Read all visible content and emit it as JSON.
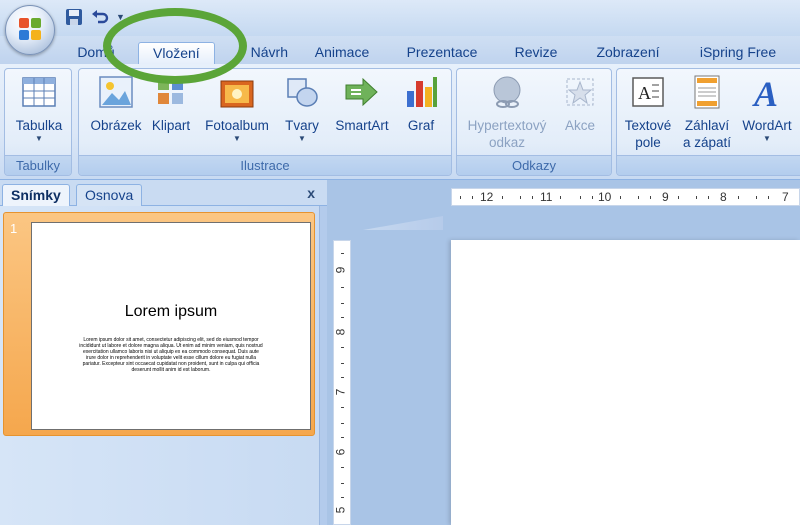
{
  "quick_access": {
    "icons": [
      "office-logo",
      "save-icon",
      "undo-icon",
      "qat-dropdown-icon"
    ]
  },
  "tabs": [
    {
      "label": "Domů"
    },
    {
      "label": "Vložení"
    },
    {
      "label": "Návrh"
    },
    {
      "label": "Animace"
    },
    {
      "label": "Prezentace"
    },
    {
      "label": "Revize"
    },
    {
      "label": "Zobrazení"
    },
    {
      "label": "iSpring Free"
    }
  ],
  "ribbon": {
    "groups": [
      {
        "label": "Tabulky",
        "buttons": [
          {
            "label": "Tabulka",
            "icon": "table-icon"
          }
        ]
      },
      {
        "label": "Ilustrace",
        "buttons": [
          {
            "label": "Obrázek",
            "icon": "picture-icon"
          },
          {
            "label": "Klipart",
            "icon": "clipart-icon"
          },
          {
            "label": "Fotoalbum",
            "icon": "photo-album-icon"
          },
          {
            "label": "Tvary",
            "icon": "shapes-icon"
          },
          {
            "label": "SmartArt",
            "icon": "smartart-icon"
          },
          {
            "label": "Graf",
            "icon": "chart-icon"
          }
        ]
      },
      {
        "label": "Odkazy",
        "buttons": [
          {
            "label_line1": "Hypertextový",
            "label_line2": "odkaz",
            "icon": "hyperlink-icon"
          },
          {
            "label": "Akce",
            "icon": "action-icon"
          }
        ]
      },
      {
        "label": "",
        "buttons": [
          {
            "label_line1": "Textové",
            "label_line2": "pole",
            "icon": "textbox-icon"
          },
          {
            "label_line1": "Záhlaví",
            "label_line2": "a zápatí",
            "icon": "header-footer-icon"
          },
          {
            "label": "WordArt",
            "icon": "wordart-icon"
          }
        ]
      }
    ]
  },
  "slide_pane": {
    "tabs": [
      "Snímky",
      "Osnova"
    ],
    "close_glyph": "x",
    "slides": [
      {
        "number": "1",
        "title": "Lorem ipsum",
        "body": "Lorem ipsum dolor sit amet, consectetur adipiscing elit, sed do eiusmod tempor incididunt ut labore et dolore magna aliqua. Ut enim ad minim veniam, quis nostrud exercitation ullamco laboris nisi ut aliquip ex ea commodo consequat. Duis aute irure dolor in reprehenderit in voluptate velit esse cillum dolore eu fugiat nulla pariatur. Excepteur sint occaecat cupidatat non proident, sunt in culpa qui officia deserunt mollit anim id est laborum."
      }
    ]
  },
  "rulers": {
    "horizontal": [
      "12",
      "11",
      "10",
      "9",
      "8",
      "7"
    ],
    "vertical": [
      "9",
      "8",
      "7",
      "6",
      "5"
    ]
  },
  "colors": {
    "highlight": "#5ba538",
    "tab_text": "#15428b"
  }
}
